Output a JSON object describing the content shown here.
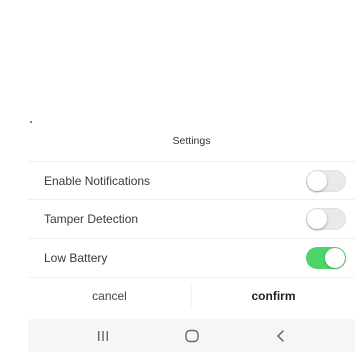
{
  "sheet": {
    "title": "Settings",
    "rows": [
      {
        "label": "Enable Notifications",
        "on": false
      },
      {
        "label": "Tamper Detection",
        "on": false
      },
      {
        "label": "Low Battery",
        "on": true
      }
    ],
    "cancel_label": "cancel",
    "confirm_label": "confirm"
  },
  "colors": {
    "toggle_on": "#4cd36a",
    "toggle_off": "#e9e9e9",
    "navbar_bg": "#f6f6f6"
  },
  "navbar": {
    "icons": [
      "recent-apps-icon",
      "home-icon",
      "back-icon"
    ]
  }
}
